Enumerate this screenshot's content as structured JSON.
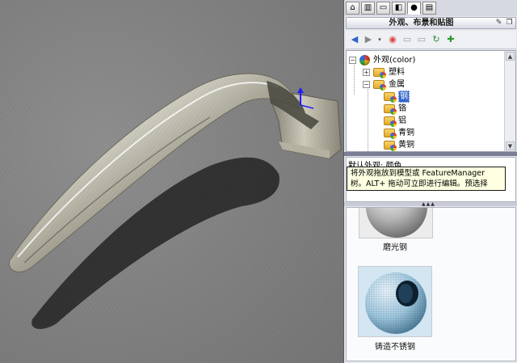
{
  "taskpane": {
    "tabs": [
      {
        "icon": "home-icon"
      },
      {
        "icon": "design-library-icon"
      },
      {
        "icon": "file-explorer-icon"
      },
      {
        "icon": "view-palette-icon"
      },
      {
        "icon": "appearances-icon",
        "active": true
      },
      {
        "icon": "custom-properties-icon"
      }
    ],
    "title": "外观、布景和贴图",
    "toolbar_icons": [
      "back-icon",
      "forward-icon",
      "add-appearance-icon",
      "open-folder-icon",
      "new-folder-icon",
      "refresh-icon",
      "favorite-icon"
    ]
  },
  "tree": {
    "root": "外观(color)",
    "items": [
      {
        "label": "塑料",
        "level": 1
      },
      {
        "label": "金属",
        "level": 1,
        "expanded": true
      },
      {
        "label": "钢",
        "level": 2,
        "selected": true
      },
      {
        "label": "铬",
        "level": 2
      },
      {
        "label": "铝",
        "level": 2
      },
      {
        "label": "青铜",
        "level": 2
      },
      {
        "label": "黄铜",
        "level": 2
      }
    ]
  },
  "description": {
    "label": "默认外观: 颜色",
    "tooltip": "将外观拖放到模型或 FeatureManager 树。ALT+ 拖动可立即进行编辑。预选择以..."
  },
  "thumbnails": [
    {
      "caption": "磨光钢"
    },
    {
      "caption": "铸造不锈钢"
    }
  ]
}
